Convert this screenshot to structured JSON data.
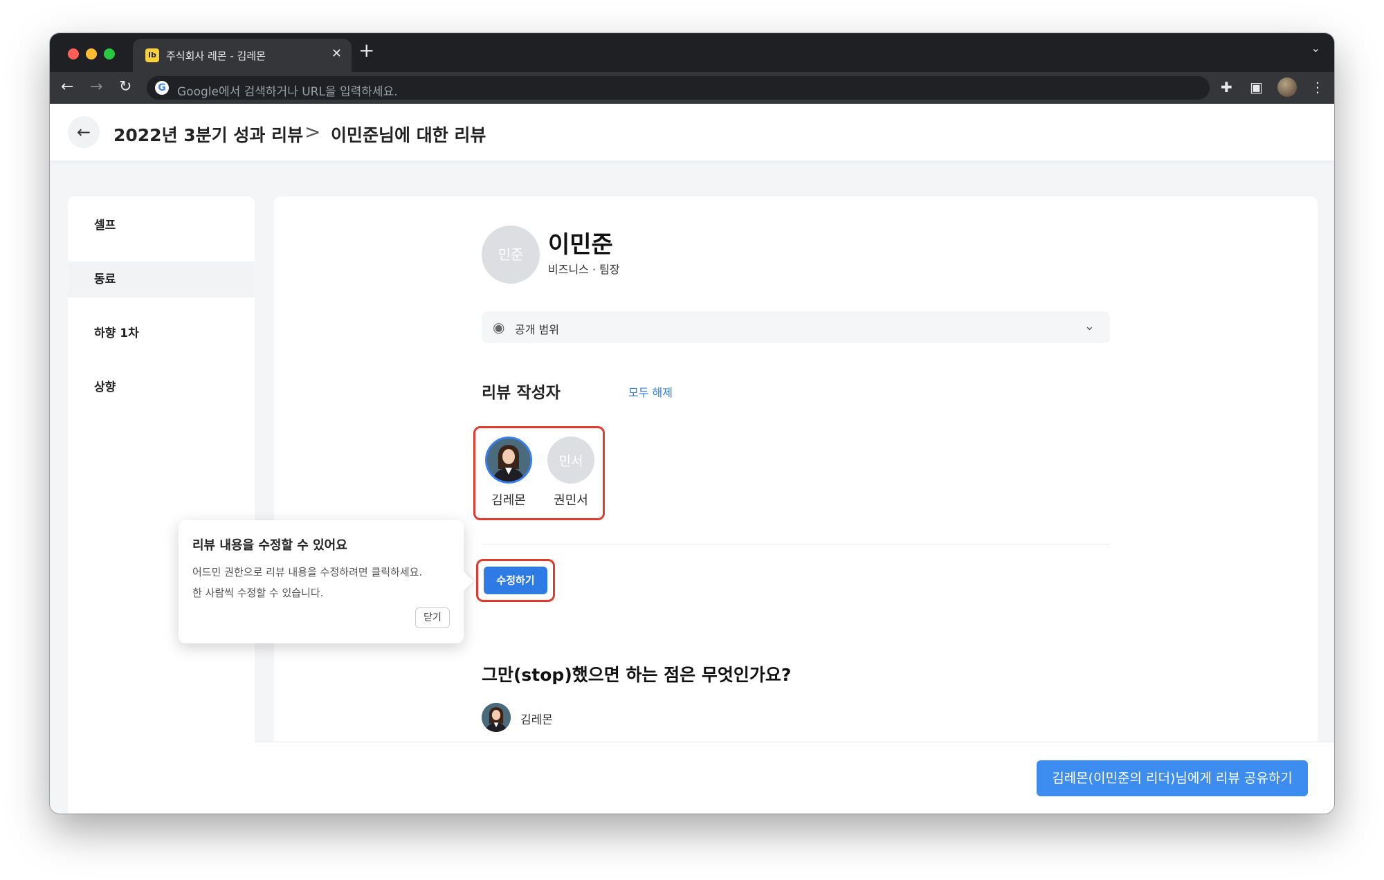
{
  "browser": {
    "tab_title": "주식회사 레몬 - 김레몬",
    "favicon_text": "lb",
    "omnibox_placeholder": "Google에서 검색하거나 URL을 입력하세요."
  },
  "header": {
    "crumb_parent": "2022년 3분기 성과 리뷰",
    "crumb_separator": ">",
    "crumb_current": "이민준님에 대한 리뷰"
  },
  "sidebar": {
    "items": [
      {
        "label": "셀프"
      },
      {
        "label": "동료",
        "active": true
      },
      {
        "label": "하향 1차"
      },
      {
        "label": "상향"
      }
    ]
  },
  "profile": {
    "avatar_initials": "민준",
    "name": "이민준",
    "subtitle": "비즈니스 · 팀장"
  },
  "visibility": {
    "label": "공개 범위"
  },
  "reviewers": {
    "title": "리뷰 작성자",
    "clear_all_label": "모두 해제",
    "list": [
      {
        "name": "김레몬",
        "avatar": "photo",
        "selected": true
      },
      {
        "name": "권민서",
        "avatar_initials": "민서",
        "selected": false
      }
    ]
  },
  "edit": {
    "button_label": "수정하기"
  },
  "tooltip": {
    "title": "리뷰 내용을 수정할 수 있어요",
    "line1": "어드민 권한으로 리뷰 내용을 수정하려면 클릭하세요.",
    "line2": "한 사람씩 수정할 수 있습니다.",
    "close_label": "닫기"
  },
  "question": {
    "text": "그만(stop)했으면 하는 점은 무엇인가요?",
    "answer_author": "김레몬"
  },
  "footer": {
    "share_button_label": "김레몬(이민준의 리더)님에게 리뷰 공유하기"
  },
  "colors": {
    "accent": "#2f7be5",
    "highlight": "#e23b2e",
    "chrome_dark": "#1f2023"
  }
}
